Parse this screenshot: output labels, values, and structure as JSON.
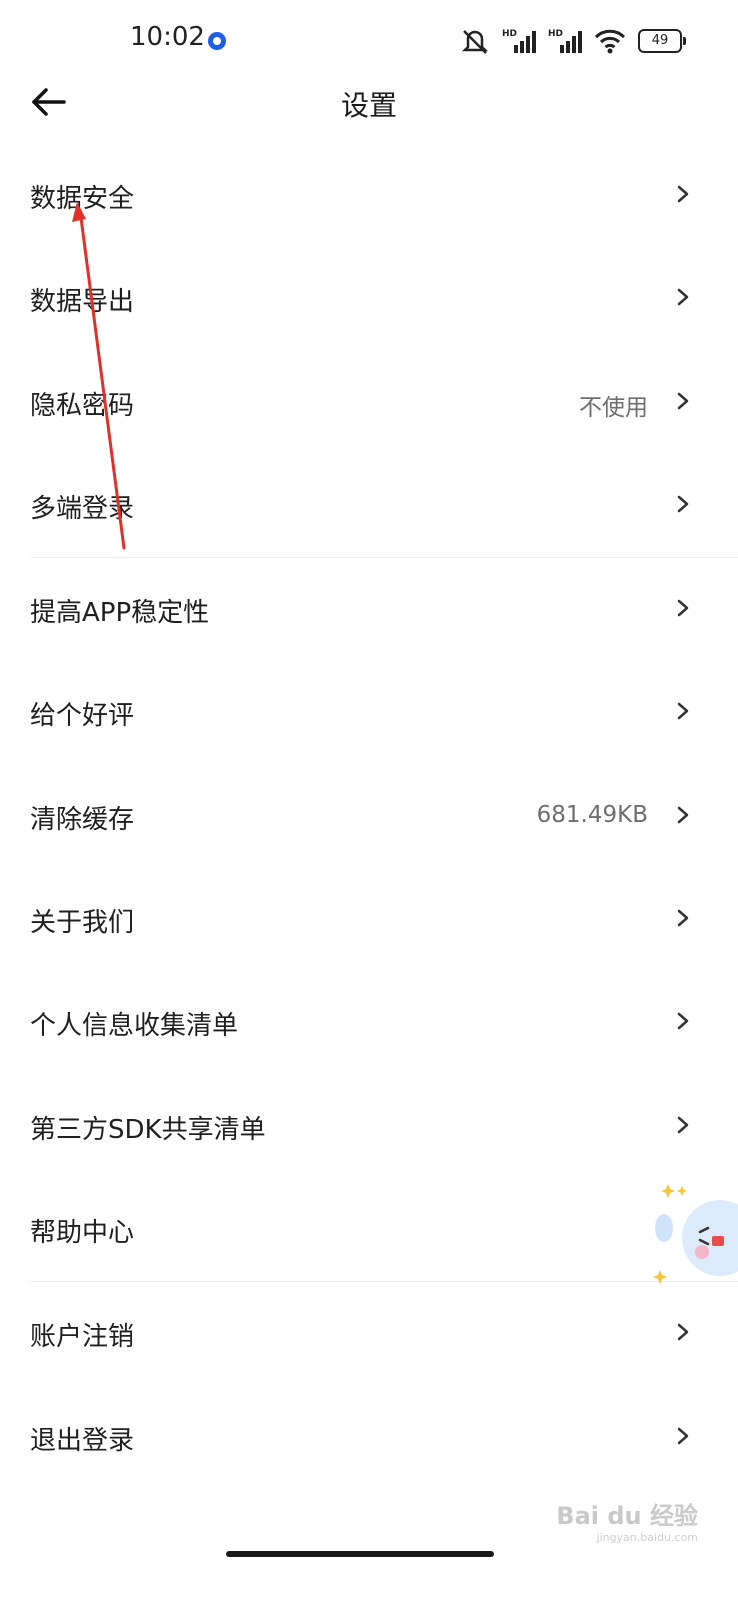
{
  "status_bar": {
    "time": "10:02",
    "battery": "49",
    "network_labels": [
      "HD",
      "HD"
    ]
  },
  "header": {
    "title": "设置"
  },
  "settings": [
    {
      "label": "数据安全",
      "value": ""
    },
    {
      "label": "数据导出",
      "value": ""
    },
    {
      "label": "隐私密码",
      "value": "不使用"
    },
    {
      "label": "多端登录",
      "value": ""
    },
    {
      "label": "提高APP稳定性",
      "value": ""
    },
    {
      "label": "给个好评",
      "value": ""
    },
    {
      "label": "清除缓存",
      "value": "681.49KB"
    },
    {
      "label": "关于我们",
      "value": ""
    },
    {
      "label": "个人信息收集清单",
      "value": ""
    },
    {
      "label": "第三方SDK共享清单",
      "value": ""
    },
    {
      "label": "帮助中心",
      "value": ""
    },
    {
      "label": "账户注销",
      "value": ""
    },
    {
      "label": "退出登录",
      "value": ""
    }
  ],
  "watermark": {
    "brand": "Bai du 经验",
    "url": "jingyan.baidu.com"
  },
  "colors": {
    "accent": "#1e5ee6",
    "annotation_arrow": "#e0302a",
    "text": "#1f1f1f",
    "secondary_text": "#6e6e6e"
  }
}
